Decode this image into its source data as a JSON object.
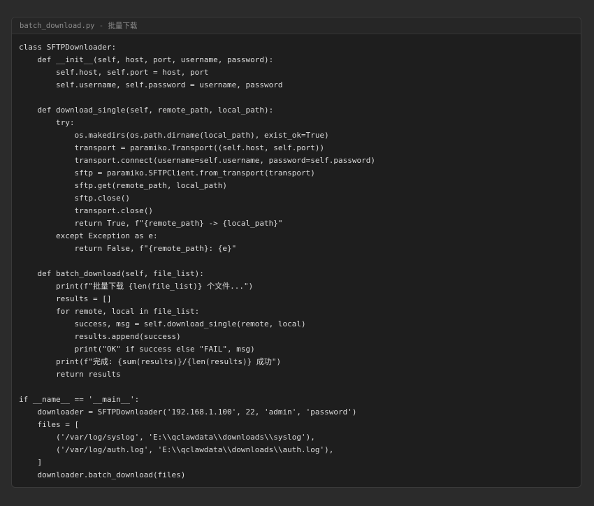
{
  "file": {
    "name": "batch_download.py",
    "separator": " - ",
    "description": "批量下载"
  },
  "code_lines": [
    "class SFTPDownloader:",
    "    def __init__(self, host, port, username, password):",
    "        self.host, self.port = host, port",
    "        self.username, self.password = username, password",
    "",
    "    def download_single(self, remote_path, local_path):",
    "        try:",
    "            os.makedirs(os.path.dirname(local_path), exist_ok=True)",
    "            transport = paramiko.Transport((self.host, self.port))",
    "            transport.connect(username=self.username, password=self.password)",
    "            sftp = paramiko.SFTPClient.from_transport(transport)",
    "            sftp.get(remote_path, local_path)",
    "            sftp.close()",
    "            transport.close()",
    "            return True, f\"{remote_path} -> {local_path}\"",
    "        except Exception as e:",
    "            return False, f\"{remote_path}: {e}\"",
    "",
    "    def batch_download(self, file_list):",
    "        print(f\"批量下载 {len(file_list)} 个文件...\")",
    "        results = []",
    "        for remote, local in file_list:",
    "            success, msg = self.download_single(remote, local)",
    "            results.append(success)",
    "            print(\"OK\" if success else \"FAIL\", msg)",
    "        print(f\"完成: {sum(results)}/{len(results)} 成功\")",
    "        return results",
    "",
    "if __name__ == '__main__':",
    "    downloader = SFTPDownloader('192.168.1.100', 22, 'admin', 'password')",
    "    files = [",
    "        ('/var/log/syslog', 'E:\\\\qclawdata\\\\downloads\\\\syslog'),",
    "        ('/var/log/auth.log', 'E:\\\\qclawdata\\\\downloads\\\\auth.log'),",
    "    ]",
    "    downloader.batch_download(files)"
  ]
}
